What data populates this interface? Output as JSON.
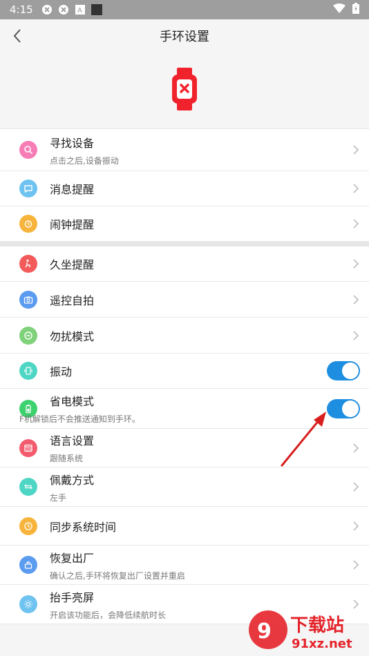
{
  "status": {
    "time": "4:15"
  },
  "header": {
    "title": "手环设置"
  },
  "colors": {
    "accent": "#1e8fe0",
    "device_red": "#f0232d"
  },
  "settings": {
    "find": {
      "label": "寻找设备",
      "sub": "点击之后,设备振动",
      "icon": "search-icon",
      "color": "#f77db6"
    },
    "message": {
      "label": "消息提醒",
      "icon": "message-icon",
      "color": "#6fc3f0"
    },
    "alarm": {
      "label": "闹钟提醒",
      "icon": "alarm-icon",
      "color": "#f7b43d"
    },
    "sedentary": {
      "label": "久坐提醒",
      "icon": "sit-icon",
      "color": "#f35b5b"
    },
    "camera": {
      "label": "遥控自拍",
      "icon": "camera-icon",
      "color": "#5b9bf0"
    },
    "dnd": {
      "label": "勿扰模式",
      "icon": "do-not-disturb-icon",
      "color": "#7fd17a"
    },
    "vibrate": {
      "label": "振动",
      "icon": "vibrate-icon",
      "color": "#4ed6c5",
      "enabled": true
    },
    "power": {
      "label": "省电模式",
      "sub": "F机解锁后不会推送通知到手环。",
      "icon": "battery-icon",
      "color": "#3dd16f",
      "enabled": true
    },
    "language": {
      "label": "语言设置",
      "sub": "跟随系统",
      "icon": "language-icon",
      "color": "#f35b6e"
    },
    "wear": {
      "label": "佩戴方式",
      "sub": "左手",
      "icon": "wear-icon",
      "color": "#4ed6c5"
    },
    "time_sync": {
      "label": "同步系统时间",
      "icon": "clock-icon",
      "color": "#f7b43d"
    },
    "reset": {
      "label": "恢复出厂",
      "sub": "确认之后,手环将恢复出厂设置并重启",
      "icon": "reset-icon",
      "color": "#5b9bf0"
    },
    "raise": {
      "label": "抬手亮屏",
      "sub": "开启该功能后，会降低续航时长",
      "icon": "sun-icon",
      "color": "#6fc3f0"
    }
  },
  "watermark": {
    "main": "下载站",
    "domain": "91xz.net"
  }
}
